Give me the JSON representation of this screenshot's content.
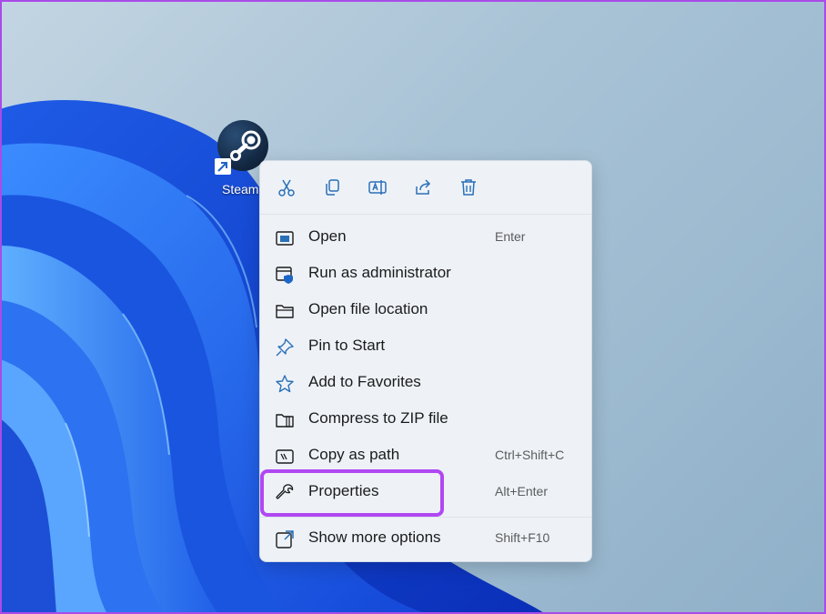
{
  "desktop": {
    "shortcut_label": "Steam",
    "frame_color": "#a94be8"
  },
  "context_menu": {
    "toolbar": [
      {
        "name": "cut",
        "icon": "scissors-icon"
      },
      {
        "name": "copy",
        "icon": "copy-icon"
      },
      {
        "name": "rename",
        "icon": "rename-icon"
      },
      {
        "name": "share",
        "icon": "share-icon"
      },
      {
        "name": "delete",
        "icon": "trash-icon"
      }
    ],
    "items": [
      {
        "label": "Open",
        "shortcut": "Enter",
        "icon": "open-icon"
      },
      {
        "label": "Run as administrator",
        "shortcut": "",
        "icon": "shield-window-icon"
      },
      {
        "label": "Open file location",
        "shortcut": "",
        "icon": "folder-icon"
      },
      {
        "label": "Pin to Start",
        "shortcut": "",
        "icon": "pin-icon"
      },
      {
        "label": "Add to Favorites",
        "shortcut": "",
        "icon": "star-icon"
      },
      {
        "label": "Compress to ZIP file",
        "shortcut": "",
        "icon": "zip-folder-icon"
      },
      {
        "label": "Copy as path",
        "shortcut": "Ctrl+Shift+C",
        "icon": "path-icon"
      },
      {
        "label": "Properties",
        "shortcut": "Alt+Enter",
        "icon": "wrench-icon"
      },
      {
        "label": "Show more options",
        "shortcut": "Shift+F10",
        "icon": "more-options-icon"
      }
    ],
    "highlight_color": "#b048f2",
    "accent": "#2a70b8"
  }
}
